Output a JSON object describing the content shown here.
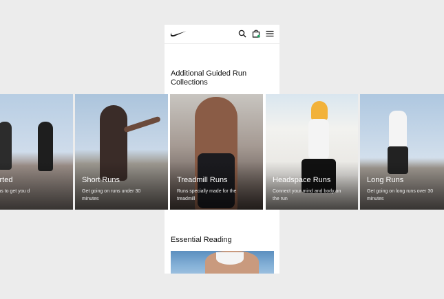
{
  "nav": {
    "logo_icon": "swoosh-logo",
    "search_icon": "search-icon",
    "bag_icon": "bag-icon",
    "menu_icon": "menu-icon"
  },
  "sections": {
    "guided_title": "Additional Guided Run Collections",
    "reading_title": "Essential Reading"
  },
  "cards": [
    {
      "title": "Started",
      "description": "re runs to get you d"
    },
    {
      "title": "Short Runs",
      "description": "Get going on runs under 30 minutes"
    },
    {
      "title": "Treadmill Runs",
      "description": "Runs specially made for the treadmill"
    },
    {
      "title": "Headspace Runs",
      "description": "Connect your mind and body on the run"
    },
    {
      "title": "Long Runs",
      "description": "Get going on long runs over 30 minutes"
    }
  ],
  "colors": {
    "text": "#111111",
    "background": "#ececec",
    "surface": "#ffffff",
    "bag_badge": "#1aa260"
  }
}
